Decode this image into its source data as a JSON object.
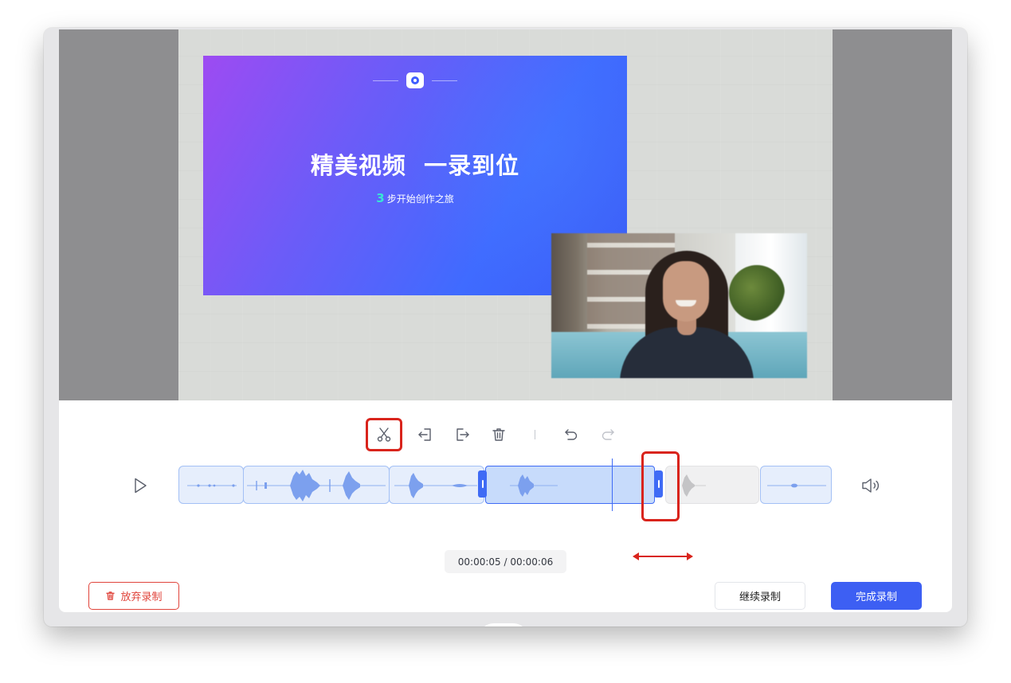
{
  "slide": {
    "title": "精美视频  一录到位",
    "subtitle_number": "3",
    "subtitle_text": "步开始创作之旅"
  },
  "toolbar": {
    "tools": [
      "scissors-icon",
      "trim-left-icon",
      "trim-right-icon",
      "trash-icon",
      "undo-icon",
      "redo-icon"
    ]
  },
  "player": {
    "time_display": "00:00:05 / 00:00:06"
  },
  "actions": {
    "discard_label": "放弃录制",
    "continue_label": "继续录制",
    "finish_label": "完成录制"
  },
  "colors": {
    "accent": "#3d5ff3",
    "danger": "#e0443b",
    "highlight": "#d9241c"
  }
}
